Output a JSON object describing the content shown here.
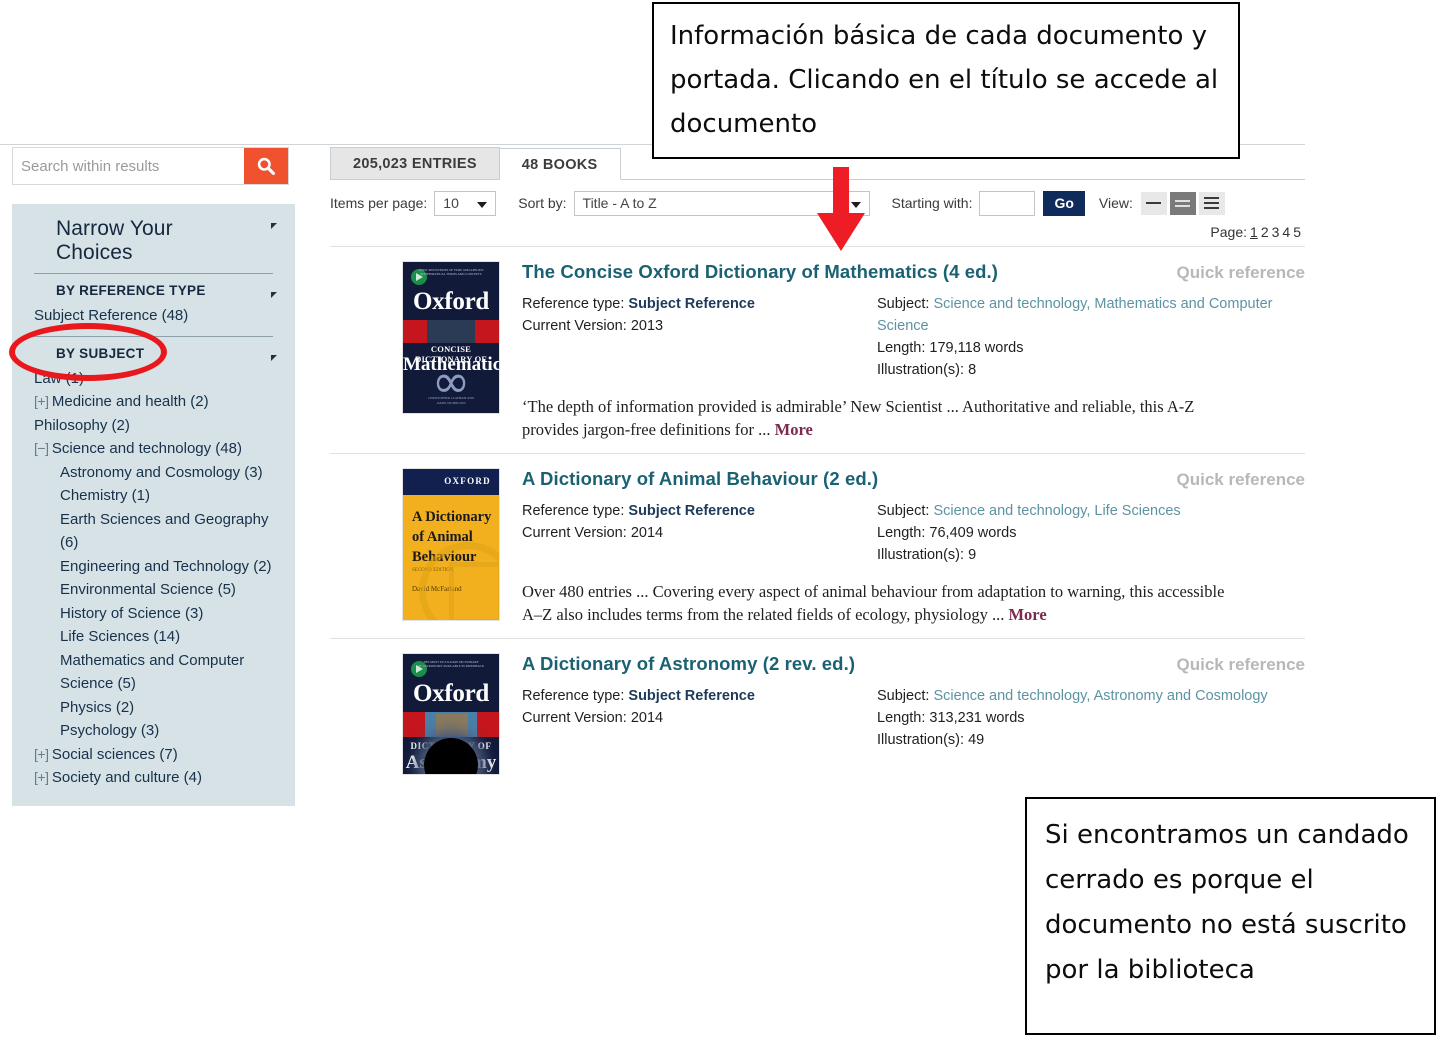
{
  "sidebar": {
    "search": {
      "placeholder": "Search within results",
      "value": "",
      "button_icon": "search-icon"
    },
    "panel_title": "Narrow Your Choices",
    "groups": [
      {
        "label": "BY REFERENCE TYPE",
        "items": [
          {
            "toggle": "",
            "label": "Subject Reference (48)",
            "indent": false
          }
        ]
      },
      {
        "label": "BY SUBJECT",
        "items": [
          {
            "toggle": "",
            "label": "Law (1)",
            "indent": false
          },
          {
            "toggle": "[+]",
            "label": "Medicine and health (2)",
            "indent": false
          },
          {
            "toggle": "",
            "label": "Philosophy (2)",
            "indent": false
          },
          {
            "toggle": "[−]",
            "label": "Science and technology (48)",
            "indent": false
          },
          {
            "toggle": "",
            "label": "Astronomy and Cosmology (3)",
            "indent": true
          },
          {
            "toggle": "",
            "label": "Chemistry (1)",
            "indent": true
          },
          {
            "toggle": "",
            "label": "Earth Sciences and Geography (6)",
            "indent": true
          },
          {
            "toggle": "",
            "label": "Engineering and Technology (2)",
            "indent": true
          },
          {
            "toggle": "",
            "label": "Environmental Science (5)",
            "indent": true
          },
          {
            "toggle": "",
            "label": "History of Science (3)",
            "indent": true
          },
          {
            "toggle": "",
            "label": "Life Sciences (14)",
            "indent": true
          },
          {
            "toggle": "",
            "label": "Mathematics and Computer Science (5)",
            "indent": true
          },
          {
            "toggle": "",
            "label": "Physics (2)",
            "indent": true
          },
          {
            "toggle": "",
            "label": "Psychology (3)",
            "indent": true
          },
          {
            "toggle": "[+]",
            "label": "Social sciences (7)",
            "indent": false
          },
          {
            "toggle": "[+]",
            "label": "Society and culture (4)",
            "indent": false
          }
        ]
      }
    ]
  },
  "tabs": [
    {
      "label": "205,023 ENTRIES",
      "active": false
    },
    {
      "label": "48 BOOKS",
      "active": true
    }
  ],
  "toolbar": {
    "items_per_page_label": "Items per page:",
    "items_per_page_value": "10",
    "sort_by_label": "Sort by:",
    "sort_by_value": "Title - A to Z",
    "starting_with_label": "Starting with:",
    "starting_with_value": "",
    "go_label": "Go",
    "view_label": "View:",
    "view_selected_index": 1
  },
  "pagination": {
    "label": "Page:",
    "pages": [
      "1",
      "2",
      "3",
      "4",
      "5"
    ],
    "current": "1"
  },
  "results": [
    {
      "title": "The Concise Oxford Dictionary of Mathematics (4 ed.)",
      "badge": "Quick reference",
      "reference_type_label": "Reference type:",
      "reference_type_value": "Subject Reference",
      "current_version_label": "Current Version:",
      "current_version_value": "2013",
      "subject_label": "Subject:",
      "subject_value": "Science and technology, Mathematics and Computer Science",
      "length_label": "Length:",
      "length_value": "179,118 words",
      "illustrations_label": "Illustration(s):",
      "illustrations_value": "8",
      "blurb": "‘The depth of information provided is admirable’ New Scientist ... Authoritative and reliable, this A-Z provides jargon-free definitions for ...",
      "more_label": "More",
      "cover": {
        "publisher": "Oxford",
        "line1": "CONCISE DICTIONARY OF",
        "line2": "Mathematics",
        "top_small": "OVER 3000 ENTRIES OF PURE AND APPLIED MATHEMATICS\nMATHEMATICAL TERMS AND CONCEPTS",
        "authors": "CHRISTOPHER CLAPHAM AND JAMES NICHOLSON"
      }
    },
    {
      "title": "A Dictionary of Animal Behaviour (2 ed.)",
      "badge": "Quick reference",
      "reference_type_label": "Reference type:",
      "reference_type_value": "Subject Reference",
      "current_version_label": "Current Version:",
      "current_version_value": "2014",
      "subject_label": "Subject:",
      "subject_value": "Science and technology, Life Sciences",
      "length_label": "Length:",
      "length_value": "76,409 words",
      "illustrations_label": "Illustration(s):",
      "illustrations_value": "9",
      "blurb": "Over 480 entries ... Covering every aspect of animal behaviour from adaptation to warning, this accessible A–Z also includes terms from the related fields of ecology, physiology ...",
      "more_label": "More",
      "cover": {
        "publisher": "OXFORD",
        "line1": "A Dictionary",
        "line2": "of Animal",
        "line3": "Behaviour",
        "edition": "SECOND EDITION",
        "authors": "David McFarland"
      }
    },
    {
      "title": "A Dictionary of Astronomy (2 rev. ed.)",
      "badge": "Quick reference",
      "reference_type_label": "Reference type:",
      "reference_type_value": "Subject Reference",
      "current_version_label": "Current Version:",
      "current_version_value": "2014",
      "subject_label": "Subject:",
      "subject_value": "Science and technology, Astronomy and Cosmology",
      "length_label": "Length:",
      "length_value": "313,231 words",
      "illustrations_label": "Illustration(s):",
      "illustrations_value": "49",
      "blurb": "",
      "more_label": "",
      "cover": {
        "publisher": "Oxford",
        "line1": "DICTIONARY OF",
        "line2": "Astronomy",
        "top_small": "THE MOST UP-TO-DATE DICTIONARY\nOF ASTRONOMY AVAILABLE IN PAPERBACK"
      }
    }
  ],
  "annotations": {
    "top_note": "Información básica de cada documento y portada. Clicando en el título se accede al documento",
    "bottom_note": "Si encontramos un candado cerrado es porque el documento no está suscrito por la biblioteca",
    "arrow_color": "#ee1c25",
    "ellipse_color": "#e8181c"
  }
}
